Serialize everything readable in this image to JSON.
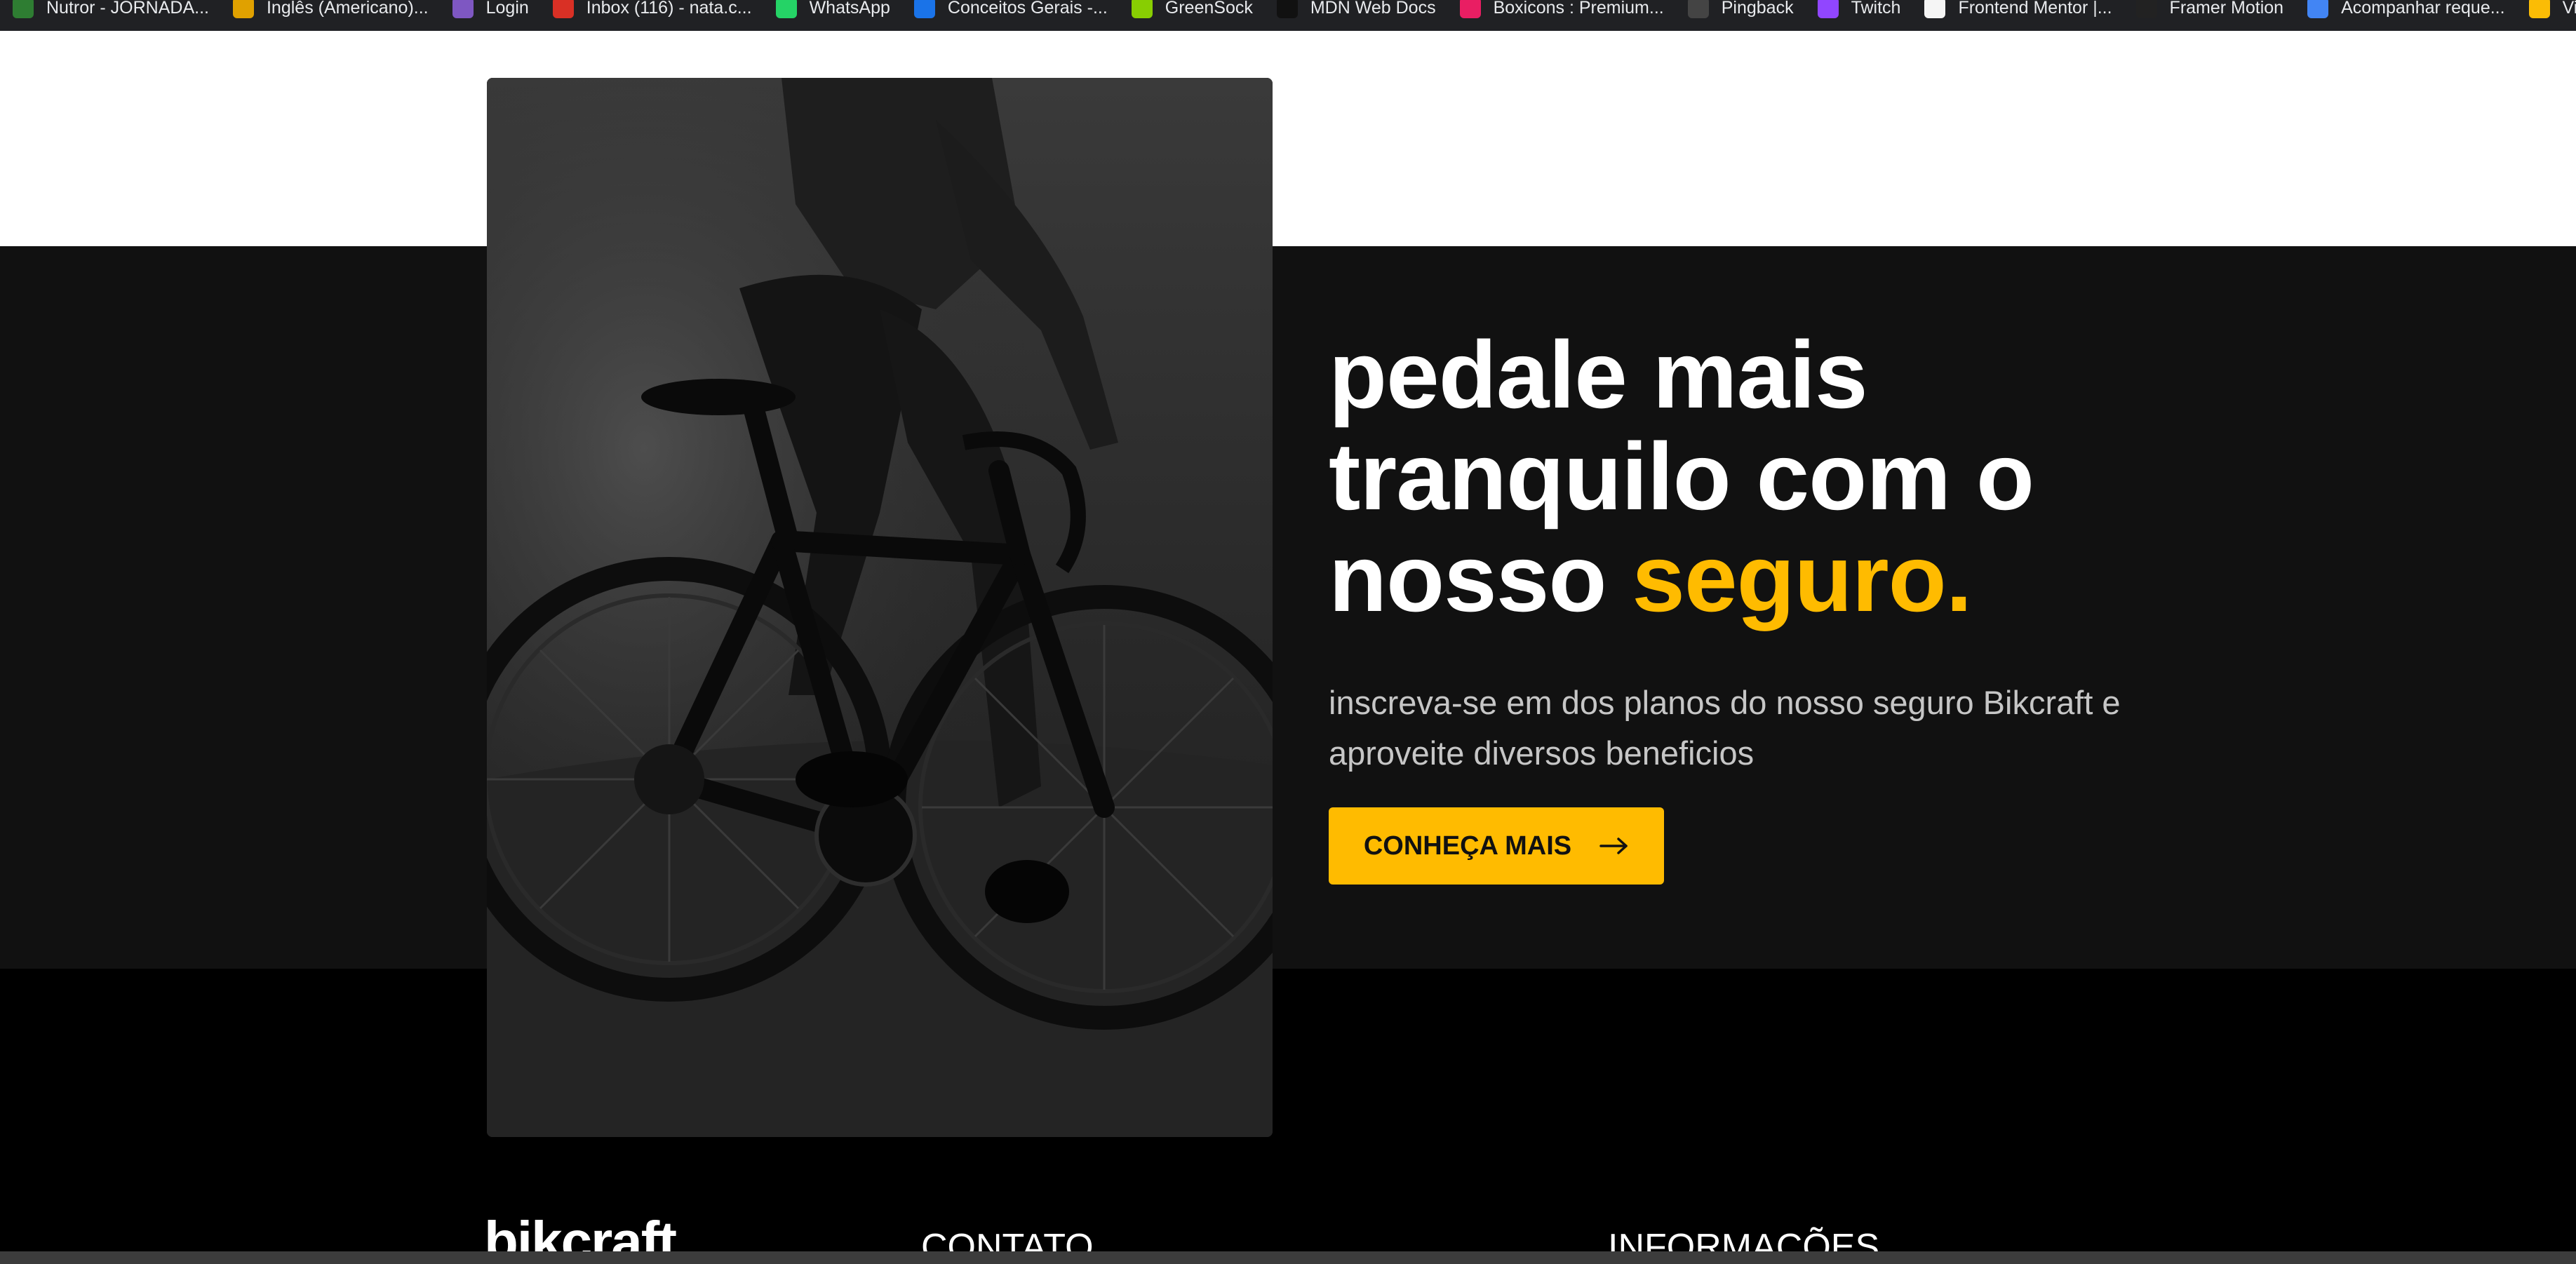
{
  "bookmarks": [
    {
      "label": "Nutror - JORNADA...",
      "color": "#2e7d32"
    },
    {
      "label": "Inglês (Americano)...",
      "color": "#e0a100"
    },
    {
      "label": "Login",
      "color": "#7e57c2"
    },
    {
      "label": "Inbox (116) - nata.c...",
      "color": "#d93025"
    },
    {
      "label": "WhatsApp",
      "color": "#25d366"
    },
    {
      "label": "Conceitos Gerais -...",
      "color": "#1a73e8"
    },
    {
      "label": "GreenSock",
      "color": "#88ce02"
    },
    {
      "label": "MDN Web Docs",
      "color": "#111111"
    },
    {
      "label": "Boxicons : Premium...",
      "color": "#e91e63"
    },
    {
      "label": "Pingback",
      "color": "#444444"
    },
    {
      "label": "Twitch",
      "color": "#9146ff"
    },
    {
      "label": "Frontend Mentor |...",
      "color": "#f5f5f5"
    },
    {
      "label": "Framer Motion",
      "color": "#222222"
    },
    {
      "label": "Acompanhar reque...",
      "color": "#4285f4"
    },
    {
      "label": "Video Recorder - Gr...",
      "color": "#fbbc05"
    }
  ],
  "hero": {
    "title_line1": "pedale mais",
    "title_line2": "tranquilo com o",
    "title_line3_start": "nosso ",
    "title_accent": "seguro.",
    "subtitle": "inscreva-se em dos planos do nosso seguro Bikcraft e aproveite diversos beneficios",
    "cta_label": "CONHEÇA MAIS",
    "cta_icon": "arrow-right-icon",
    "image_alt": "ciclista-bicicleta"
  },
  "footer": {
    "logo": "bikcraft",
    "contact_heading": "CONTATO",
    "info_heading": "INFORMAÇÕES"
  },
  "colors": {
    "accent": "#ffbb00",
    "dark_band": "#111111",
    "footer_bg": "#000000"
  }
}
